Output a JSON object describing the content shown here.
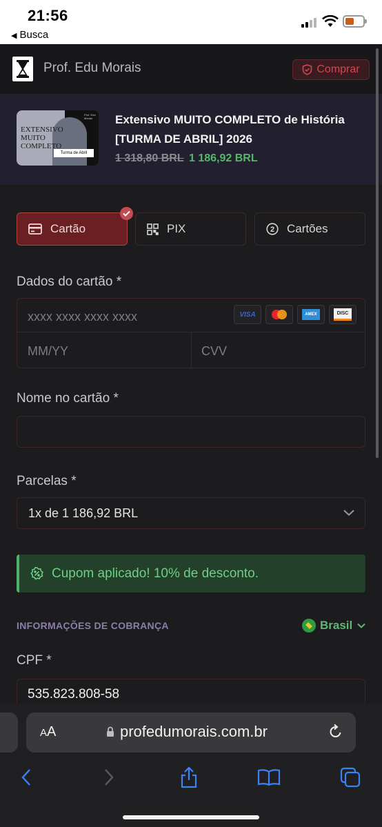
{
  "status_bar": {
    "time": "21:56",
    "back_label": "Busca"
  },
  "header": {
    "brand": "Prof. Edu Morais",
    "buy_label": "Comprar"
  },
  "product": {
    "thumb_title": "EXTENSIVO MUITO COMPLETO",
    "thumb_tag": "Turma de Abril",
    "thumb_small": "Prof. Edu Morais",
    "title": "Extensivo MUITO COMPLETO de História [TURMA DE ABRIL] 2026",
    "old_price": "1 318,80 BRL",
    "new_price": "1 186,92 BRL"
  },
  "payment_tabs": [
    {
      "label": "Cartão",
      "icon": "credit-card-icon",
      "active": true
    },
    {
      "label": "PIX",
      "icon": "qr-code-icon",
      "active": false
    },
    {
      "label": "Cartões",
      "icon": "number-2-icon",
      "active": false
    }
  ],
  "card": {
    "section_label": "Dados do cartão *",
    "number_placeholder": "xxxx xxxx xxxx xxxx",
    "expiry_placeholder": "MM/YY",
    "cvv_placeholder": "CVV",
    "brands": [
      "VISA",
      "mastercard",
      "AMEX",
      "DISC"
    ]
  },
  "name": {
    "label": "Nome no cartão *",
    "value": ""
  },
  "installments": {
    "label": "Parcelas *",
    "value": "1x de 1 186,92 BRL"
  },
  "coupon": {
    "message": "Cupom aplicado! 10% de desconto."
  },
  "billing": {
    "title": "INFORMAÇÕES DE COBRANÇA",
    "country": "Brasil"
  },
  "cpf": {
    "label": "CPF *",
    "value": "535.823.808-58"
  },
  "safari": {
    "aa_label": "AA",
    "url": "profedumorais.com.br"
  },
  "colors": {
    "accent": "#6b1f22",
    "success": "#55b86a",
    "danger": "#d9434f"
  }
}
